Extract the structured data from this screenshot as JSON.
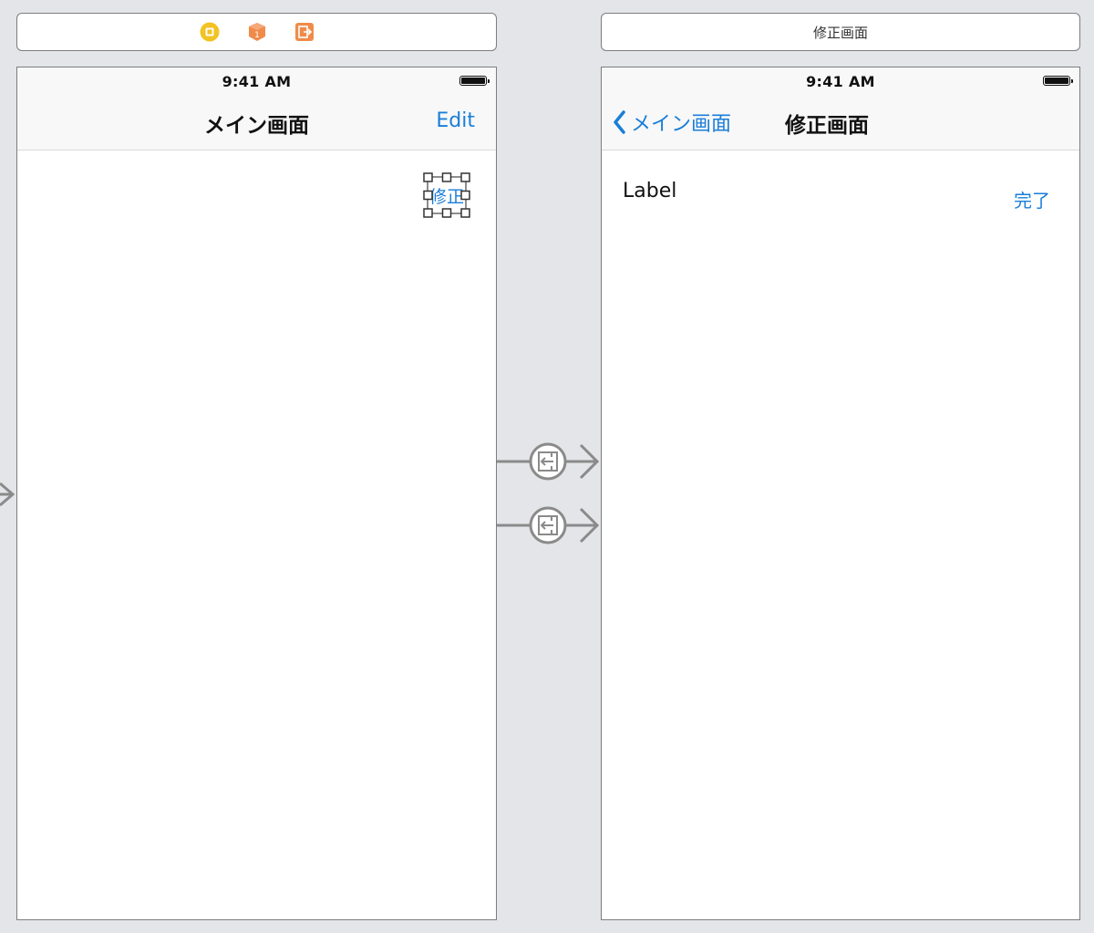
{
  "colors": {
    "canvas": "#e4e5e8",
    "tint": "#1a7ed8",
    "segue": "#8a8a8a",
    "icon_yellow": "#f3c223",
    "icon_orange": "#f08b4a"
  },
  "left_scene": {
    "dock_icons": [
      "view-controller-icon",
      "first-responder-icon",
      "exit-icon"
    ],
    "status_time": "9:41 AM",
    "nav_title": "メイン画面",
    "nav_right": "Edit",
    "selected_button": "修正"
  },
  "right_scene": {
    "bar_title": "修正画面",
    "status_time": "9:41 AM",
    "back_label": "メイン画面",
    "nav_title": "修正画面",
    "label": "Label",
    "done": "完了"
  },
  "segues": [
    {
      "from": "left_scene",
      "to": "right_scene",
      "icon": "show-segue-icon"
    },
    {
      "from": "left_scene",
      "to": "right_scene",
      "icon": "show-segue-icon"
    }
  ]
}
